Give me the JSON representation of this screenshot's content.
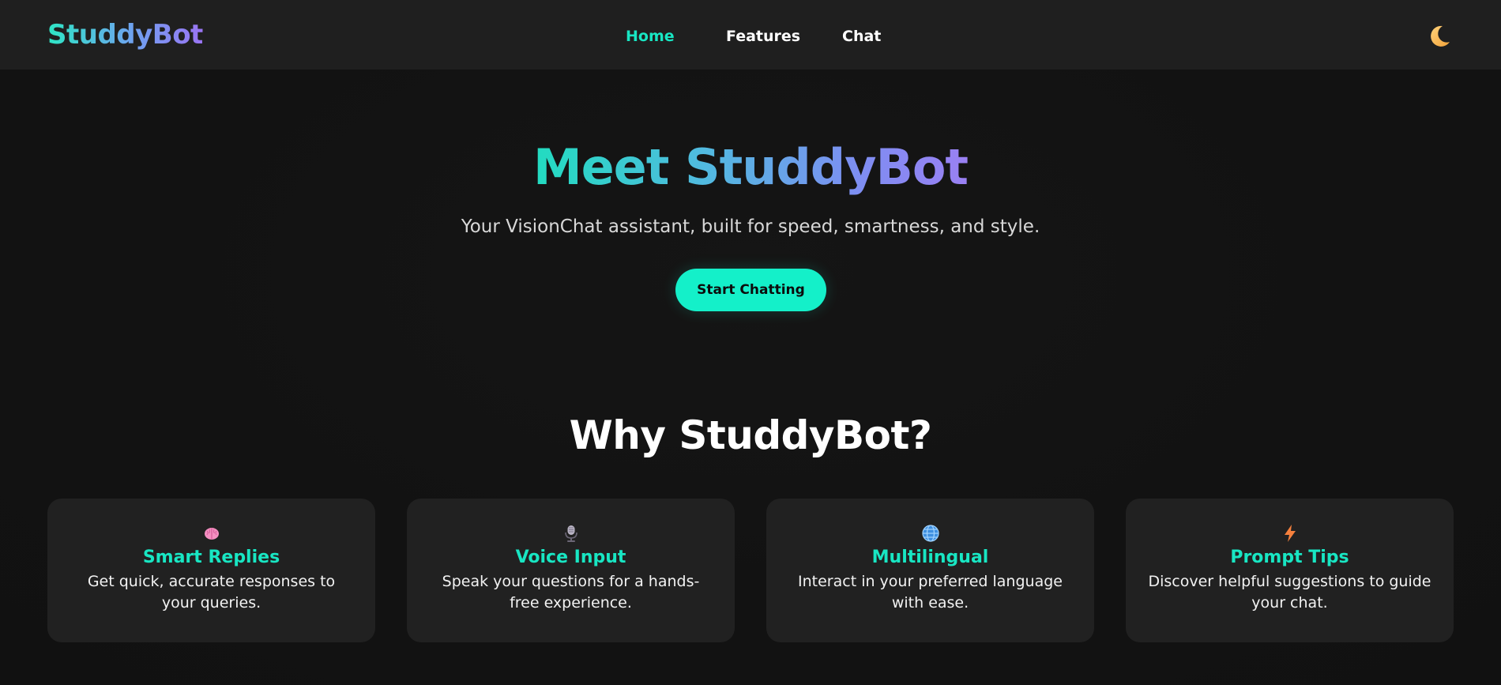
{
  "navbar": {
    "brand": "StuddyBot",
    "links": [
      {
        "label": "Home",
        "active": true
      },
      {
        "label": "Features",
        "active": false
      },
      {
        "label": "Chat",
        "active": false
      }
    ],
    "theme_toggle_icon": "crescent-moon-icon"
  },
  "hero": {
    "title": "Meet StuddyBot",
    "subtitle": "Your VisionChat assistant, built for speed, smartness, and style.",
    "cta_label": "Start Chatting"
  },
  "features": {
    "title": "Why StuddyBot?",
    "cards": [
      {
        "icon": "brain-icon",
        "title": "Smart Replies",
        "description": "Get quick, accurate responses to your queries."
      },
      {
        "icon": "microphone-icon",
        "title": "Voice Input",
        "description": "Speak your questions for a hands-free experience."
      },
      {
        "icon": "globe-icon",
        "title": "Multilingual",
        "description": "Interact in your preferred language with ease."
      },
      {
        "icon": "lightning-icon",
        "title": "Prompt Tips",
        "description": "Discover helpful suggestions to guide your chat."
      }
    ]
  },
  "colors": {
    "background": "#121212",
    "navbar": "#1f1f1f",
    "card": "#212121",
    "accent": "#18e6c3",
    "cta": "#14f0c9",
    "gradient_start": "#22dcc0",
    "gradient_end": "#9a80f3"
  }
}
